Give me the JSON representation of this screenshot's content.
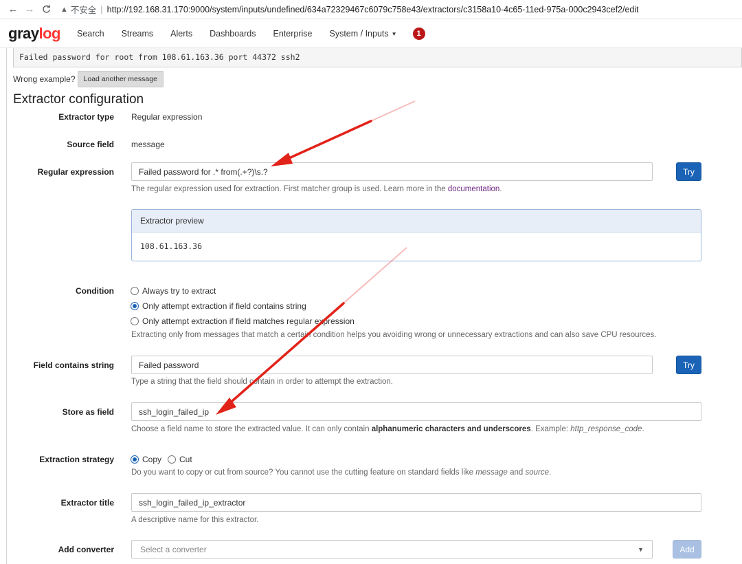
{
  "browser": {
    "back_glyph": "←",
    "forward_glyph": "→",
    "reload_glyph": "C",
    "warning_glyph": "▲",
    "insecure_label": "不安全",
    "separator": "|",
    "url": "http://192.168.31.170:9000/system/inputs/undefined/634a72329467c6079c758e43/extractors/c3158a10-4c65-11ed-975a-000c2943cef2/edit"
  },
  "navbar": {
    "brand_part1": "gray",
    "brand_part2": "log",
    "items": [
      "Search",
      "Streams",
      "Alerts",
      "Dashboards",
      "Enterprise",
      "System / Inputs"
    ],
    "caret": "▼",
    "notification_count": "1",
    "brand_color": "#ff3633",
    "badge_color": "#ba1818"
  },
  "message": {
    "text": "Failed password for root from 108.61.163.36 port 44372 ssh2",
    "wrong_example_label": "Wrong example?",
    "load_another_label": "Load another message"
  },
  "config": {
    "title": "Extractor configuration",
    "extractor_type": {
      "label": "Extractor type",
      "value": "Regular expression"
    },
    "source_field": {
      "label": "Source field",
      "value": "message"
    },
    "regex": {
      "label": "Regular expression",
      "value": "Failed password for .* from(.+?)\\s.?",
      "try_label": "Try",
      "help_prefix": "The regular expression used for extraction. First matcher group is used. Learn more in the ",
      "help_link": "documentation",
      "help_suffix": "."
    },
    "preview": {
      "title": "Extractor preview",
      "value": "108.61.163.36"
    },
    "condition": {
      "label": "Condition",
      "options": [
        "Always try to extract",
        "Only attempt extraction if field contains string",
        "Only attempt extraction if field matches regular expression"
      ],
      "selected_index": 1,
      "help": "Extracting only from messages that match a certain condition helps you avoiding wrong or unnecessary extractions and can also save CPU resources."
    },
    "field_contains": {
      "label": "Field contains string",
      "value": "Failed password",
      "try_label": "Try",
      "help": "Type a string that the field should contain in order to attempt the extraction."
    },
    "store_as": {
      "label": "Store as field",
      "value": "ssh_login_failed_ip",
      "help_prefix": "Choose a field name to store the extracted value. It can only contain ",
      "help_bold": "alphanumeric characters and underscores",
      "help_mid": ". Example: ",
      "help_example": "http_response_code",
      "help_suffix": "."
    },
    "strategy": {
      "label": "Extraction strategy",
      "options": [
        "Copy",
        "Cut"
      ],
      "selected_index": 0,
      "help_prefix": "Do you want to copy or cut from source? You cannot use the cutting feature on standard fields like ",
      "help_em1": "message",
      "help_mid": " and ",
      "help_em2": "source",
      "help_suffix": "."
    },
    "title_field": {
      "label": "Extractor title",
      "value": "ssh_login_failed_ip_extractor",
      "help": "A descriptive name for this extractor."
    },
    "converter": {
      "label": "Add converter",
      "placeholder": "Select a converter",
      "arrow_glyph": "▼",
      "add_label": "Add"
    }
  },
  "colors": {
    "primary_button": "#1a63b6",
    "link": "#702785",
    "annotation_arrow": "#e2231a"
  }
}
